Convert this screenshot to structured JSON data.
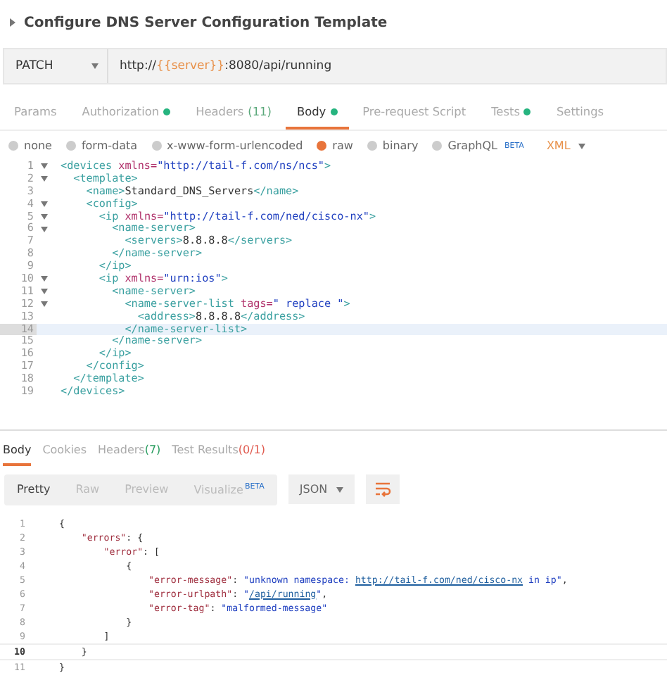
{
  "request": {
    "title": "Configure DNS Server Configuration Template",
    "expanded": false,
    "method": "PATCH",
    "url": [
      {
        "kind": "plain",
        "text": "http://"
      },
      {
        "kind": "var",
        "text": "{{server}}"
      },
      {
        "kind": "plain",
        "text": ":8080/api/running"
      }
    ]
  },
  "tabs": [
    {
      "label": "Params",
      "selected": false,
      "dot": false
    },
    {
      "label": "Authorization",
      "selected": false,
      "dot": true
    },
    {
      "label": "Headers",
      "count": "(11)",
      "selected": false,
      "dot": false
    },
    {
      "label": "Body",
      "selected": true,
      "dot": true
    },
    {
      "label": "Pre-request Script",
      "selected": false,
      "dot": false
    },
    {
      "label": "Tests",
      "selected": false,
      "dot": true
    },
    {
      "label": "Settings",
      "selected": false,
      "dot": false
    }
  ],
  "body_types": [
    {
      "label": "none",
      "selected": false
    },
    {
      "label": "form-data",
      "selected": false
    },
    {
      "label": "x-www-form-urlencoded",
      "selected": false
    },
    {
      "label": "raw",
      "selected": true
    },
    {
      "label": "binary",
      "selected": false
    },
    {
      "label": "GraphQL",
      "badge": "BETA",
      "selected": false
    }
  ],
  "format": "XML",
  "editor": [
    {
      "number": "1",
      "fold": true,
      "active": false,
      "parts": [
        {
          "kind": "tag",
          "text": "<devices"
        },
        {
          "kind": "attr",
          "text": " xmlns="
        },
        {
          "kind": "str",
          "text": "\"http://tail-f.com/ns/ncs\""
        },
        {
          "kind": "tag",
          "text": ">"
        }
      ]
    },
    {
      "number": "2",
      "fold": true,
      "active": false,
      "parts": [
        {
          "kind": "tag",
          "text": "  <template>"
        }
      ]
    },
    {
      "number": "3",
      "fold": false,
      "active": false,
      "parts": [
        {
          "kind": "tag",
          "text": "    <name>"
        },
        {
          "kind": "plain",
          "text": "Standard_DNS_Servers"
        },
        {
          "kind": "tag",
          "text": "</name>"
        }
      ]
    },
    {
      "number": "4",
      "fold": true,
      "active": false,
      "parts": [
        {
          "kind": "tag",
          "text": "    <config>"
        }
      ]
    },
    {
      "number": "5",
      "fold": true,
      "active": false,
      "parts": [
        {
          "kind": "tag",
          "text": "      <ip"
        },
        {
          "kind": "attr",
          "text": " xmlns="
        },
        {
          "kind": "str",
          "text": "\"http://tail-f.com/ned/cisco-nx\""
        },
        {
          "kind": "tag",
          "text": ">"
        }
      ]
    },
    {
      "number": "6",
      "fold": true,
      "active": false,
      "parts": [
        {
          "kind": "tag",
          "text": "        <name-server>"
        }
      ]
    },
    {
      "number": "7",
      "fold": false,
      "active": false,
      "parts": [
        {
          "kind": "tag",
          "text": "          <servers>"
        },
        {
          "kind": "plain",
          "text": "8.8.8.8"
        },
        {
          "kind": "tag",
          "text": "</servers>"
        }
      ]
    },
    {
      "number": "8",
      "fold": false,
      "active": false,
      "parts": [
        {
          "kind": "tag",
          "text": "        </name-server>"
        }
      ]
    },
    {
      "number": "9",
      "fold": false,
      "active": false,
      "parts": [
        {
          "kind": "tag",
          "text": "      </ip>"
        }
      ]
    },
    {
      "number": "10",
      "fold": true,
      "active": false,
      "parts": [
        {
          "kind": "tag",
          "text": "      <ip"
        },
        {
          "kind": "attr",
          "text": " xmlns="
        },
        {
          "kind": "str",
          "text": "\"urn:ios\""
        },
        {
          "kind": "tag",
          "text": ">"
        }
      ]
    },
    {
      "number": "11",
      "fold": true,
      "active": false,
      "parts": [
        {
          "kind": "tag",
          "text": "        <name-server>"
        }
      ]
    },
    {
      "number": "12",
      "fold": true,
      "active": false,
      "parts": [
        {
          "kind": "tag",
          "text": "          <name-server-list"
        },
        {
          "kind": "attr",
          "text": " tags="
        },
        {
          "kind": "str",
          "text": "\" replace \""
        },
        {
          "kind": "tag",
          "text": ">"
        }
      ]
    },
    {
      "number": "13",
      "fold": false,
      "active": false,
      "parts": [
        {
          "kind": "tag",
          "text": "            <address>"
        },
        {
          "kind": "plain",
          "text": "8.8.8.8"
        },
        {
          "kind": "tag",
          "text": "</address>"
        }
      ]
    },
    {
      "number": "14",
      "fold": false,
      "active": true,
      "parts": [
        {
          "kind": "tag",
          "text": "          </name-server-list>"
        }
      ]
    },
    {
      "number": "15",
      "fold": false,
      "active": false,
      "parts": [
        {
          "kind": "tag",
          "text": "        </name-server>"
        }
      ]
    },
    {
      "number": "16",
      "fold": false,
      "active": false,
      "parts": [
        {
          "kind": "tag",
          "text": "      </ip>"
        }
      ]
    },
    {
      "number": "17",
      "fold": false,
      "active": false,
      "parts": [
        {
          "kind": "tag",
          "text": "    </config>"
        }
      ]
    },
    {
      "number": "18",
      "fold": false,
      "active": false,
      "parts": [
        {
          "kind": "tag",
          "text": "  </template>"
        }
      ]
    },
    {
      "number": "19",
      "fold": false,
      "active": false,
      "parts": [
        {
          "kind": "tag",
          "text": "</devices>"
        }
      ]
    }
  ],
  "response_tabs": [
    {
      "label": "Body",
      "selected": true
    },
    {
      "label": "Cookies",
      "selected": false
    },
    {
      "label": "Headers",
      "count": "(7)",
      "color": "#2a9d60",
      "selected": false
    },
    {
      "label": "Test Results",
      "count": "(0/1)",
      "color": "#e05a4f",
      "selected": false
    }
  ],
  "views": [
    {
      "label": "Pretty",
      "selected": true
    },
    {
      "label": "Raw",
      "selected": false
    },
    {
      "label": "Preview",
      "selected": false
    },
    {
      "label": "Visualize",
      "badge": "BETA",
      "selected": false
    }
  ],
  "response_format": "JSON",
  "response": [
    {
      "number": "1",
      "active": false,
      "parts": [
        {
          "kind": "punct",
          "text": "{"
        }
      ]
    },
    {
      "number": "2",
      "active": false,
      "parts": [
        {
          "kind": "key",
          "text": "    \"errors\""
        },
        {
          "kind": "punct",
          "text": ": {"
        }
      ]
    },
    {
      "number": "3",
      "active": false,
      "parts": [
        {
          "kind": "key",
          "text": "        \"error\""
        },
        {
          "kind": "punct",
          "text": ": ["
        }
      ]
    },
    {
      "number": "4",
      "active": false,
      "parts": [
        {
          "kind": "punct",
          "text": "            {"
        }
      ]
    },
    {
      "number": "5",
      "active": false,
      "parts": [
        {
          "kind": "key",
          "text": "                \"error-message\""
        },
        {
          "kind": "punct",
          "text": ": "
        },
        {
          "kind": "str",
          "text": "\"unknown namespace: "
        },
        {
          "kind": "link",
          "text": "http://tail-f.com/ned/cisco-nx"
        },
        {
          "kind": "str",
          "text": " in ip\""
        },
        {
          "kind": "punct",
          "text": ","
        }
      ]
    },
    {
      "number": "6",
      "active": false,
      "parts": [
        {
          "kind": "key",
          "text": "                \"error-urlpath\""
        },
        {
          "kind": "punct",
          "text": ": "
        },
        {
          "kind": "str",
          "text": "\""
        },
        {
          "kind": "link",
          "text": "/api/running"
        },
        {
          "kind": "str",
          "text": "\""
        },
        {
          "kind": "punct",
          "text": ","
        }
      ]
    },
    {
      "number": "7",
      "active": false,
      "parts": [
        {
          "kind": "key",
          "text": "                \"error-tag\""
        },
        {
          "kind": "punct",
          "text": ": "
        },
        {
          "kind": "str",
          "text": "\"malformed-message\""
        }
      ]
    },
    {
      "number": "8",
      "active": false,
      "parts": [
        {
          "kind": "punct",
          "text": "            }"
        }
      ]
    },
    {
      "number": "9",
      "active": false,
      "parts": [
        {
          "kind": "punct",
          "text": "        ]"
        }
      ]
    },
    {
      "number": "10",
      "active": true,
      "parts": [
        {
          "kind": "punct",
          "text": "    }"
        }
      ]
    },
    {
      "number": "11",
      "active": false,
      "parts": [
        {
          "kind": "punct",
          "text": "}"
        }
      ]
    }
  ]
}
